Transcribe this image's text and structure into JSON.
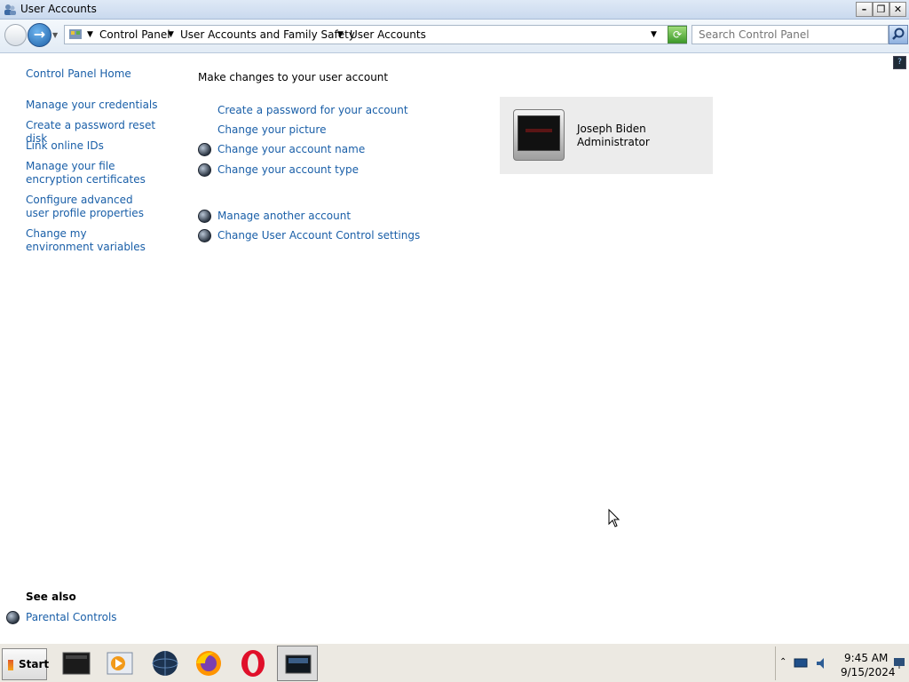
{
  "window": {
    "title": "User Accounts"
  },
  "addressbar": {
    "breadcrumbs": [
      "Control Panel",
      "User Accounts and Family Safety",
      "User Accounts"
    ],
    "search_placeholder": "Search Control Panel"
  },
  "sidebar": {
    "home": "Control Panel Home",
    "items": [
      "Manage your credentials",
      "Create a password reset disk",
      "Link online IDs",
      "Manage your file encryption certificates",
      "Configure advanced user profile properties",
      "Change my environment variables"
    ],
    "see_also_heading": "See also",
    "see_also_items": [
      "Parental Controls"
    ]
  },
  "main": {
    "heading": "Make changes to your user account",
    "tasks": [
      "Create a password for your account",
      "Change your picture",
      "Change your account name",
      "Change your account type",
      "Manage another account",
      "Change User Account Control settings"
    ]
  },
  "user": {
    "name": "Joseph Biden",
    "role": "Administrator"
  },
  "taskbar": {
    "start_label": "Start",
    "apps": [
      "terminal-icon",
      "media-player-icon",
      "globe-browser-icon",
      "firefox-icon",
      "opera-icon",
      "control-panel-icon"
    ],
    "time": "9:45 AM",
    "date": "9/15/2024"
  },
  "colors": {
    "link": "#1a5fa8",
    "tile_bg": "#ececec",
    "taskbar_bg": "#ece9e2"
  }
}
